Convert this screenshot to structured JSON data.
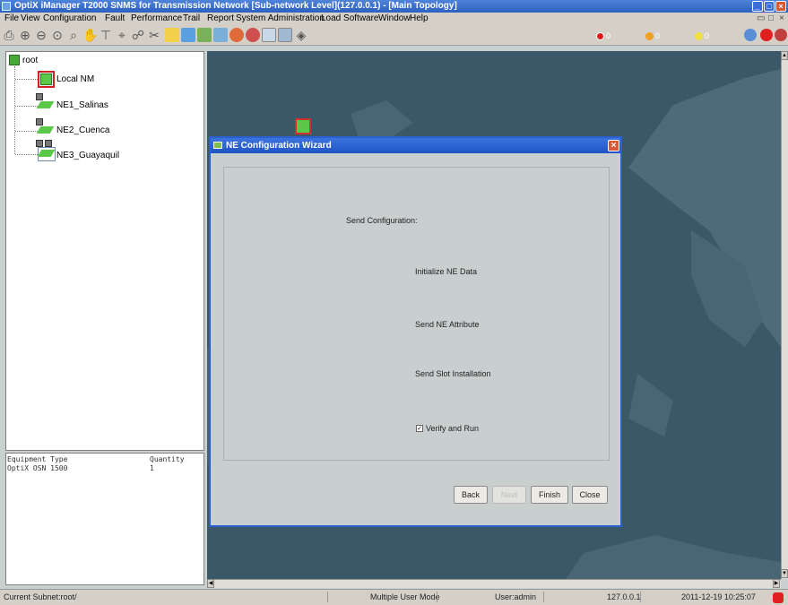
{
  "window": {
    "title": "OptiX iManager T2000 SNMS for Transmission Network [Sub-network Level](127.0.0.1) - [Main Topology]",
    "minimize": "_",
    "maximize": "□",
    "close": "×"
  },
  "menu": [
    "File",
    "View",
    "Configuration",
    "Fault",
    "Performance",
    "Trail",
    "Report",
    "System Administration",
    "Load Software",
    "Window",
    "Help"
  ],
  "alarms": {
    "critical": "0",
    "major": "0",
    "minor": "0",
    "warning": "0"
  },
  "tree": {
    "root": "root",
    "nodes": [
      "Local NM",
      "NE1_Salinas",
      "NE2_Cuenca",
      "NE3_Guayaquil"
    ]
  },
  "equipment_table": {
    "headers": [
      "Equipment Type",
      "Quantity"
    ],
    "rows": [
      [
        "OptiX OSN 1500",
        "1"
      ]
    ]
  },
  "dialog": {
    "title": "NE Configuration Wizard",
    "heading": "Send Configuration:",
    "steps": [
      "Initialize NE Data",
      "Send NE Attribute",
      "Send Slot Installation"
    ],
    "verify_label": "Verify and Run",
    "verify_checked": true,
    "buttons": {
      "back": "Back",
      "next": "Next",
      "finish": "Finish",
      "close": "Close"
    }
  },
  "status": {
    "subnet": "Current Subnet:root/",
    "user_mode": "Multiple User Mode",
    "user": "User:admin",
    "ip": "127.0.0.1",
    "datetime": "2011-12-19 10:25:07"
  },
  "colors": {
    "title_bar": "#2c5fc0",
    "map_background": "#3a5868",
    "dialog_border": "#2a60d0",
    "ne_green": "#5cc84a"
  }
}
